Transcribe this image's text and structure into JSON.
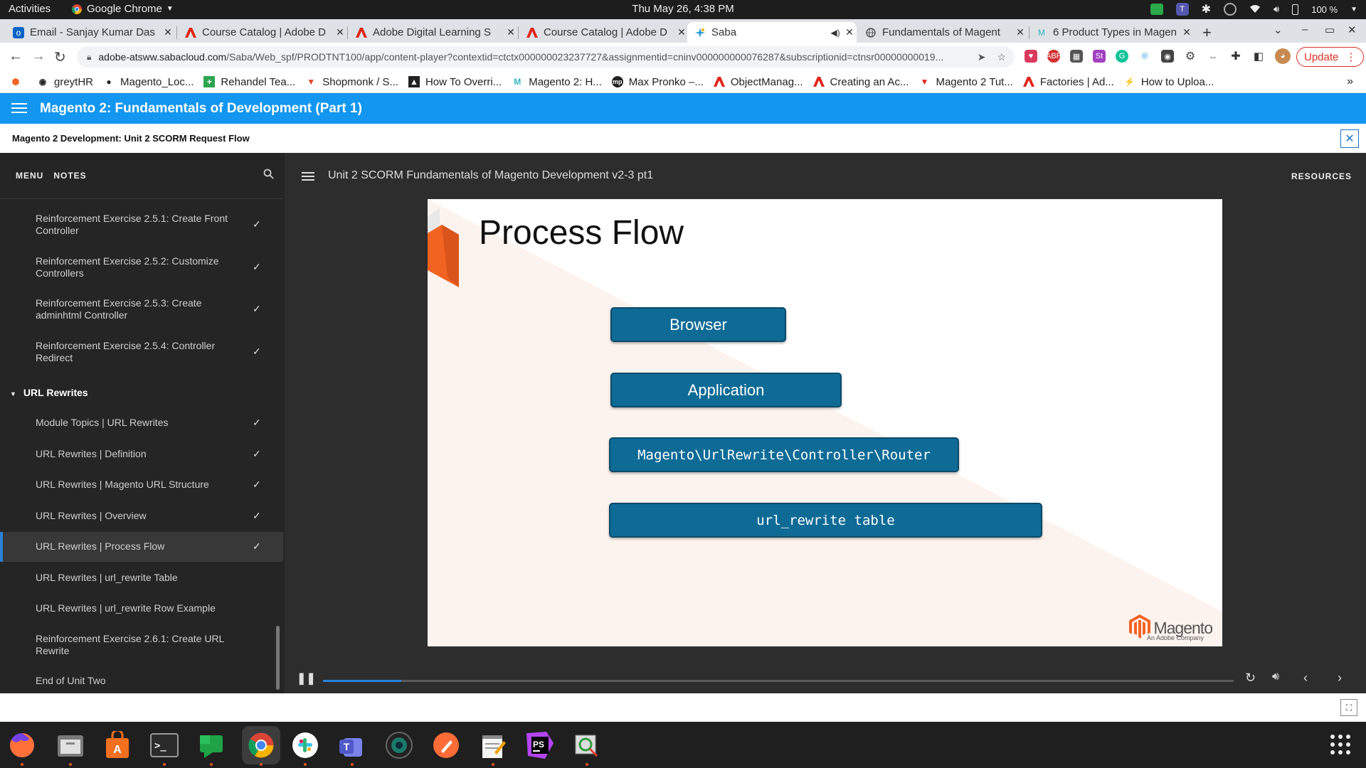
{
  "system_bar": {
    "activities": "Activities",
    "app_name": "Google Chrome",
    "clock": "Thu May 26,  4:38 PM",
    "battery": "100 %"
  },
  "tabs": [
    {
      "title": "Email - Sanjay Kumar Das",
      "icon": "outlook-icon",
      "color": "#0a64c8"
    },
    {
      "title": "Course Catalog | Adobe D",
      "icon": "adobe-icon",
      "color": "#e1251b"
    },
    {
      "title": "Adobe Digital Learning S",
      "icon": "adobe-icon",
      "color": "#e1251b"
    },
    {
      "title": "Course Catalog | Adobe D",
      "icon": "adobe-icon",
      "color": "#e1251b"
    },
    {
      "title": "Saba",
      "icon": "saba-icon",
      "color": "#2a9bd8",
      "active": true
    },
    {
      "title": "Fundamentals of Magent",
      "icon": "globe-icon",
      "color": "#555555"
    },
    {
      "title": "6 Product Types in Magen",
      "icon": "m-icon",
      "color": "#35b7c4"
    }
  ],
  "address_bar": {
    "host": "adobe-atsww.sabacloud.com",
    "path": "/Saba/Web_spf/PRODTNT100/app/content-player?contextid=ctctx000000023237727&assignmentid=cninv000000000076287&subscriptionid=ctnsr00000000019..."
  },
  "update_button": "Update",
  "bookmarks": [
    {
      "label": "greytHR",
      "icon": "greythr-icon",
      "color": "#111111"
    },
    {
      "label": "Magento_Loc...",
      "icon": "github-icon",
      "color": "#111111"
    },
    {
      "label": "Rehandel Tea...",
      "icon": "plus-green-icon",
      "color": "#2ea44f"
    },
    {
      "label": "Shopmonk / S...",
      "icon": "gitlab-icon",
      "color": "#e24329"
    },
    {
      "label": "How To Overri...",
      "icon": "image-icon",
      "color": "#333333"
    },
    {
      "label": "Magento 2: H...",
      "icon": "m-icon",
      "color": "#35b7c4"
    },
    {
      "label": "Max Pronko –...",
      "icon": "mp-icon",
      "color": "#333333"
    },
    {
      "label": "ObjectManag...",
      "icon": "adobe-icon",
      "color": "#e1251b"
    },
    {
      "label": "Creating an Ac...",
      "icon": "adobe-icon",
      "color": "#e1251b"
    },
    {
      "label": "Magento 2 Tut...",
      "icon": "v-icon",
      "color": "#e1251b"
    },
    {
      "label": "Factories | Ad...",
      "icon": "adobe-icon",
      "color": "#e1251b"
    },
    {
      "label": "How to Uploa...",
      "icon": "k-icon",
      "color": "#f0a000"
    }
  ],
  "course": {
    "title": "Magento 2: Fundamentals of Development (Part 1)",
    "subtitle": "Magento 2 Development: Unit 2 SCORM Request Flow"
  },
  "sidebar": {
    "menu_tab": "MENU",
    "notes_tab": "NOTES",
    "items": [
      {
        "label": "Reinforcement Exercise 2.5.1: Create Front Controller",
        "done": true
      },
      {
        "label": "Reinforcement Exercise 2.5.2: Customize Controllers",
        "done": true
      },
      {
        "label": "Reinforcement Exercise 2.5.3: Create adminhtml Controller",
        "done": true
      },
      {
        "label": "Reinforcement Exercise 2.5.4: Controller Redirect",
        "done": true
      }
    ],
    "section": "URL Rewrites",
    "section_items": [
      {
        "label": "Module Topics | URL Rewrites",
        "done": true
      },
      {
        "label": "URL Rewrites | Definition",
        "done": true
      },
      {
        "label": "URL Rewrites | Magento URL Structure",
        "done": true
      },
      {
        "label": "URL Rewrites | Overview",
        "done": true
      },
      {
        "label": "URL Rewrites | Process Flow",
        "done": true,
        "current": true
      },
      {
        "label": "URL Rewrites | url_rewrite Table",
        "done": false
      },
      {
        "label": "URL Rewrites | url_rewrite Row Example",
        "done": false
      },
      {
        "label": "Reinforcement Exercise 2.6.1: Create URL Rewrite",
        "done": false
      },
      {
        "label": "End of Unit Two",
        "done": false
      }
    ]
  },
  "player": {
    "content_title": "Unit 2 SCORM Fundamentals of Magento Development v2-3 pt1",
    "resources": "RESOURCES",
    "progress": 0.086
  },
  "slide": {
    "heading": "Process Flow",
    "boxes": [
      "Browser",
      "Application",
      "Magento\\UrlRewrite\\Controller\\Router",
      "url_rewrite  table"
    ],
    "logo_word": "Magento",
    "logo_sub": "An Adobe Company",
    "accent": "#f26322",
    "box_color": "#0e6b96"
  },
  "dock_apps": [
    "firefox-icon",
    "files-icon",
    "software-icon",
    "terminal-icon",
    "chat-icon",
    "chrome-icon",
    "slack-icon",
    "teams-icon",
    "camera-icon",
    "postman-icon",
    "text-editor-icon",
    "phpstorm-icon",
    "screenshot-icon",
    "app-grid-icon"
  ]
}
